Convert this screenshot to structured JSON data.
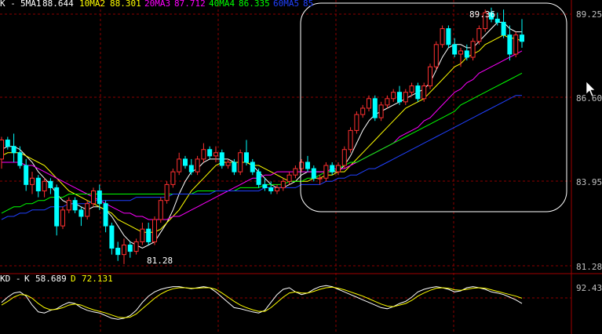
{
  "header": {
    "prefix": "K -",
    "indicators": [
      {
        "name": "5MA1",
        "value": "88.644",
        "color": "#ffffff"
      },
      {
        "name": "10MA2",
        "value": "88.301",
        "color": "#ffff00"
      },
      {
        "name": "20MA3",
        "value": "87.712",
        "color": "#ff00ff"
      },
      {
        "name": "40MA4",
        "value": "86.335",
        "color": "#00ff00"
      },
      {
        "name": "60MA5",
        "value": "85",
        "color": "#0000ff"
      }
    ]
  },
  "price_axis": {
    "ticks": [
      "89.25",
      "86.60",
      "83.95",
      "81.28"
    ]
  },
  "annotations": {
    "high": "89.36",
    "low": "81.28"
  },
  "kd": {
    "prefix": "KD -",
    "k_label": "K",
    "k_value": "58.689",
    "d_label": "D",
    "d_value": "72.131",
    "axis_tick": "92.434"
  },
  "colors": {
    "up": "#ff3030",
    "down": "#00ffff",
    "grid": "#8b0000",
    "axis": "#a00000",
    "highlight": "#ffffff"
  },
  "chart_data": {
    "type": "candlestick",
    "ylim": [
      81.0,
      89.6
    ],
    "candles": [
      [
        84.6,
        85.3,
        84.3,
        85.2
      ],
      [
        85.2,
        85.3,
        84.9,
        85.0
      ],
      [
        85.0,
        85.4,
        84.5,
        84.8
      ],
      [
        84.8,
        85.0,
        84.3,
        84.4
      ],
      [
        84.4,
        84.6,
        83.6,
        83.8
      ],
      [
        83.8,
        84.2,
        83.5,
        84.0
      ],
      [
        84.0,
        84.1,
        83.4,
        83.6
      ],
      [
        83.6,
        84.0,
        83.4,
        83.9
      ],
      [
        83.9,
        84.0,
        83.5,
        83.7
      ],
      [
        83.7,
        83.8,
        82.2,
        82.5
      ],
      [
        82.5,
        83.1,
        82.4,
        83.0
      ],
      [
        83.0,
        83.4,
        82.9,
        83.3
      ],
      [
        83.3,
        83.4,
        82.9,
        83.0
      ],
      [
        83.0,
        83.1,
        82.5,
        82.8
      ],
      [
        82.8,
        83.3,
        82.7,
        83.2
      ],
      [
        83.2,
        83.7,
        83.1,
        83.6
      ],
      [
        83.6,
        83.8,
        83.0,
        83.2
      ],
      [
        83.2,
        83.3,
        82.3,
        82.5
      ],
      [
        82.5,
        82.6,
        81.6,
        81.8
      ],
      [
        81.8,
        82.0,
        81.4,
        81.6
      ],
      [
        81.6,
        82.1,
        81.3,
        81.9
      ],
      [
        81.9,
        82.0,
        81.5,
        81.7
      ],
      [
        81.7,
        82.1,
        81.6,
        82.0
      ],
      [
        82.0,
        82.6,
        81.9,
        82.4
      ],
      [
        82.4,
        82.6,
        81.9,
        82.0
      ],
      [
        82.0,
        82.8,
        81.9,
        82.7
      ],
      [
        82.7,
        83.4,
        82.6,
        83.3
      ],
      [
        83.3,
        83.9,
        83.2,
        83.8
      ],
      [
        83.8,
        84.3,
        83.7,
        84.2
      ],
      [
        84.2,
        84.8,
        84.1,
        84.6
      ],
      [
        84.6,
        84.7,
        84.3,
        84.4
      ],
      [
        84.4,
        84.6,
        84.1,
        84.2
      ],
      [
        84.2,
        84.7,
        84.1,
        84.6
      ],
      [
        84.6,
        85.1,
        84.5,
        84.9
      ],
      [
        84.9,
        85.0,
        84.6,
        84.7
      ],
      [
        84.7,
        85.0,
        84.5,
        84.8
      ],
      [
        84.8,
        84.9,
        84.3,
        84.4
      ],
      [
        84.4,
        84.6,
        84.3,
        84.5
      ],
      [
        84.5,
        84.6,
        84.1,
        84.2
      ],
      [
        84.2,
        84.9,
        84.1,
        84.8
      ],
      [
        84.8,
        85.2,
        84.4,
        84.5
      ],
      [
        84.5,
        84.6,
        84.1,
        84.2
      ],
      [
        84.2,
        84.3,
        83.7,
        83.8
      ],
      [
        83.8,
        84.0,
        83.6,
        83.7
      ],
      [
        83.7,
        83.9,
        83.5,
        83.6
      ],
      [
        83.6,
        83.8,
        83.5,
        83.7
      ],
      [
        83.7,
        84.0,
        83.6,
        83.9
      ],
      [
        83.9,
        84.2,
        83.8,
        84.1
      ],
      [
        84.1,
        84.4,
        84.0,
        84.3
      ],
      [
        84.3,
        84.6,
        84.2,
        84.5
      ],
      [
        84.5,
        84.7,
        84.2,
        84.3
      ],
      [
        84.3,
        84.4,
        83.9,
        84.0
      ],
      [
        84.0,
        84.1,
        83.8,
        84.0
      ],
      [
        84.0,
        84.5,
        83.9,
        84.4
      ],
      [
        84.4,
        84.5,
        84.1,
        84.2
      ],
      [
        84.2,
        84.5,
        84.1,
        84.4
      ],
      [
        84.4,
        85.0,
        84.3,
        84.9
      ],
      [
        84.9,
        85.6,
        84.8,
        85.5
      ],
      [
        85.5,
        86.1,
        85.4,
        86.0
      ],
      [
        86.0,
        86.3,
        85.9,
        86.2
      ],
      [
        86.2,
        86.6,
        86.1,
        86.5
      ],
      [
        86.5,
        86.6,
        85.8,
        85.9
      ],
      [
        85.9,
        86.4,
        85.8,
        86.3
      ],
      [
        86.3,
        86.6,
        86.2,
        86.5
      ],
      [
        86.5,
        86.8,
        86.4,
        86.7
      ],
      [
        86.7,
        86.9,
        86.3,
        86.4
      ],
      [
        86.4,
        86.8,
        86.3,
        86.7
      ],
      [
        86.7,
        87.0,
        86.6,
        86.9
      ],
      [
        86.9,
        87.0,
        86.4,
        86.5
      ],
      [
        86.5,
        87.0,
        86.4,
        86.9
      ],
      [
        86.9,
        87.6,
        86.8,
        87.5
      ],
      [
        87.5,
        88.3,
        87.4,
        88.2
      ],
      [
        88.2,
        88.8,
        88.1,
        88.7
      ],
      [
        88.7,
        88.8,
        88.1,
        88.2
      ],
      [
        88.2,
        88.4,
        87.8,
        87.9
      ],
      [
        87.9,
        88.1,
        87.5,
        88.0
      ],
      [
        88.0,
        88.2,
        87.7,
        87.8
      ],
      [
        87.8,
        88.4,
        87.7,
        88.3
      ],
      [
        88.3,
        88.8,
        88.2,
        88.7
      ],
      [
        88.7,
        89.3,
        88.6,
        89.2
      ],
      [
        89.2,
        89.36,
        88.9,
        89.0
      ],
      [
        89.0,
        89.2,
        88.8,
        88.9
      ],
      [
        88.9,
        89.3,
        88.4,
        88.5
      ],
      [
        88.5,
        88.8,
        87.7,
        87.9
      ],
      [
        87.9,
        88.6,
        87.8,
        88.5
      ],
      [
        88.5,
        89.0,
        88.1,
        88.3
      ]
    ],
    "moving_averages": {
      "MA5": [
        84.9,
        85.0,
        85.0,
        84.9,
        84.7,
        84.5,
        84.2,
        84.0,
        83.8,
        83.5,
        83.3,
        83.2,
        83.2,
        83.1,
        83.0,
        83.1,
        83.1,
        83.0,
        82.8,
        82.5,
        82.2,
        82.0,
        81.9,
        81.8,
        81.9,
        82.0,
        82.3,
        82.6,
        83.0,
        83.5,
        83.9,
        84.2,
        84.3,
        84.5,
        84.6,
        84.6,
        84.6,
        84.6,
        84.5,
        84.5,
        84.5,
        84.4,
        84.2,
        84.0,
        83.8,
        83.7,
        83.7,
        83.8,
        83.9,
        84.1,
        84.2,
        84.2,
        84.2,
        84.2,
        84.2,
        84.2,
        84.4,
        84.7,
        85.1,
        85.5,
        85.8,
        86.0,
        86.1,
        86.2,
        86.3,
        86.4,
        86.5,
        86.6,
        86.7,
        86.8,
        87.0,
        87.4,
        87.8,
        88.1,
        88.2,
        88.2,
        88.1,
        88.1,
        88.3,
        88.5,
        88.7,
        88.9,
        88.9,
        88.7,
        88.6,
        88.6
      ],
      "MA10": [
        84.7,
        84.8,
        84.8,
        84.8,
        84.7,
        84.6,
        84.5,
        84.4,
        84.2,
        84.0,
        83.8,
        83.6,
        83.5,
        83.4,
        83.3,
        83.2,
        83.1,
        83.0,
        82.9,
        82.7,
        82.6,
        82.5,
        82.4,
        82.3,
        82.3,
        82.3,
        82.4,
        82.6,
        82.8,
        83.0,
        83.3,
        83.6,
        83.8,
        84.0,
        84.2,
        84.4,
        84.5,
        84.5,
        84.5,
        84.5,
        84.5,
        84.4,
        84.4,
        84.3,
        84.2,
        84.1,
        84.0,
        83.9,
        83.9,
        83.9,
        83.9,
        84.0,
        84.0,
        84.1,
        84.1,
        84.2,
        84.2,
        84.4,
        84.6,
        84.8,
        85.0,
        85.2,
        85.4,
        85.6,
        85.8,
        86.0,
        86.2,
        86.3,
        86.4,
        86.5,
        86.7,
        86.9,
        87.1,
        87.3,
        87.5,
        87.6,
        87.8,
        87.9,
        88.0,
        88.2,
        88.3,
        88.4,
        88.5,
        88.4,
        88.4,
        88.3
      ],
      "MA20": [
        84.5,
        84.5,
        84.5,
        84.5,
        84.4,
        84.4,
        84.3,
        84.2,
        84.1,
        84.0,
        83.9,
        83.8,
        83.7,
        83.6,
        83.5,
        83.4,
        83.3,
        83.2,
        83.1,
        83.0,
        82.9,
        82.9,
        82.8,
        82.8,
        82.7,
        82.7,
        82.7,
        82.7,
        82.8,
        82.8,
        82.9,
        83.0,
        83.1,
        83.2,
        83.3,
        83.4,
        83.5,
        83.6,
        83.7,
        83.8,
        83.9,
        84.0,
        84.0,
        84.1,
        84.1,
        84.2,
        84.2,
        84.2,
        84.2,
        84.2,
        84.2,
        84.2,
        84.2,
        84.2,
        84.3,
        84.3,
        84.3,
        84.4,
        84.5,
        84.6,
        84.7,
        84.8,
        84.9,
        85.0,
        85.1,
        85.3,
        85.4,
        85.5,
        85.6,
        85.8,
        85.9,
        86.1,
        86.3,
        86.5,
        86.7,
        86.8,
        87.0,
        87.1,
        87.3,
        87.4,
        87.5,
        87.6,
        87.7,
        87.8,
        87.9,
        88.0
      ],
      "MA40": [
        82.9,
        83.0,
        83.1,
        83.1,
        83.2,
        83.2,
        83.3,
        83.3,
        83.4,
        83.4,
        83.4,
        83.5,
        83.5,
        83.5,
        83.5,
        83.5,
        83.5,
        83.5,
        83.5,
        83.5,
        83.5,
        83.5,
        83.5,
        83.5,
        83.5,
        83.5,
        83.5,
        83.5,
        83.5,
        83.5,
        83.5,
        83.5,
        83.6,
        83.6,
        83.6,
        83.6,
        83.6,
        83.6,
        83.6,
        83.7,
        83.7,
        83.7,
        83.7,
        83.8,
        83.8,
        83.8,
        83.8,
        83.9,
        83.9,
        83.9,
        84.0,
        84.0,
        84.1,
        84.2,
        84.2,
        84.3,
        84.4,
        84.5,
        84.5,
        84.6,
        84.7,
        84.8,
        84.9,
        85.0,
        85.1,
        85.2,
        85.3,
        85.4,
        85.5,
        85.6,
        85.7,
        85.8,
        85.9,
        86.0,
        86.1,
        86.3,
        86.4,
        86.5,
        86.6,
        86.7,
        86.8,
        86.9,
        87.0,
        87.1,
        87.2,
        87.3
      ],
      "MA60": [
        82.7,
        82.8,
        82.8,
        82.9,
        82.9,
        83.0,
        83.0,
        83.0,
        83.1,
        83.1,
        83.1,
        83.2,
        83.2,
        83.2,
        83.2,
        83.3,
        83.3,
        83.3,
        83.3,
        83.3,
        83.3,
        83.3,
        83.4,
        83.4,
        83.4,
        83.4,
        83.4,
        83.4,
        83.5,
        83.5,
        83.5,
        83.5,
        83.5,
        83.5,
        83.5,
        83.6,
        83.6,
        83.6,
        83.6,
        83.6,
        83.6,
        83.6,
        83.6,
        83.7,
        83.7,
        83.7,
        83.7,
        83.7,
        83.7,
        83.8,
        83.8,
        83.8,
        83.8,
        83.9,
        83.9,
        84.0,
        84.0,
        84.1,
        84.1,
        84.2,
        84.3,
        84.3,
        84.4,
        84.5,
        84.6,
        84.7,
        84.8,
        84.9,
        85.0,
        85.1,
        85.2,
        85.3,
        85.4,
        85.5,
        85.6,
        85.7,
        85.8,
        85.9,
        86.0,
        86.1,
        86.2,
        86.3,
        86.4,
        86.5,
        86.6,
        86.6
      ]
    },
    "kd_series": {
      "K": [
        60,
        70,
        78,
        80,
        72,
        55,
        42,
        40,
        45,
        48,
        55,
        60,
        58,
        50,
        45,
        42,
        40,
        35,
        30,
        28,
        30,
        35,
        45,
        60,
        72,
        80,
        85,
        88,
        90,
        90,
        88,
        86,
        88,
        90,
        88,
        80,
        70,
        60,
        50,
        48,
        45,
        42,
        40,
        45,
        60,
        75,
        85,
        88,
        80,
        75,
        78,
        85,
        90,
        92,
        90,
        85,
        80,
        75,
        70,
        65,
        60,
        55,
        50,
        48,
        52,
        58,
        62,
        70,
        80,
        85,
        88,
        90,
        88,
        85,
        80,
        82,
        88,
        90,
        88,
        85,
        80,
        78,
        75,
        70,
        65,
        58
      ],
      "D": [
        55,
        62,
        70,
        75,
        74,
        68,
        58,
        50,
        46,
        47,
        50,
        55,
        57,
        55,
        50,
        46,
        43,
        40,
        36,
        32,
        31,
        32,
        38,
        48,
        58,
        68,
        76,
        82,
        86,
        88,
        88,
        87,
        87,
        88,
        88,
        85,
        78,
        70,
        62,
        55,
        50,
        46,
        43,
        43,
        50,
        60,
        70,
        78,
        80,
        78,
        78,
        81,
        85,
        88,
        89,
        87,
        84,
        80,
        76,
        72,
        67,
        62,
        57,
        53,
        52,
        55,
        58,
        64,
        72,
        78,
        83,
        87,
        88,
        87,
        84,
        83,
        85,
        87,
        88,
        87,
        84,
        81,
        78,
        75,
        72,
        68
      ]
    }
  }
}
